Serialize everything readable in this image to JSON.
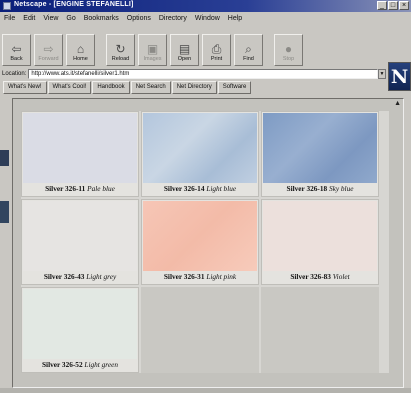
{
  "window": {
    "title": "Netscape - [ENGINE STEFANELLI]"
  },
  "menu": [
    "File",
    "Edit",
    "View",
    "Go",
    "Bookmarks",
    "Options",
    "Directory",
    "Window",
    "Help"
  ],
  "toolbar": [
    {
      "label": "Back",
      "icon": "back-arrow-icon",
      "glyph": "⇦",
      "enabled": true
    },
    {
      "label": "Forward",
      "icon": "forward-arrow-icon",
      "glyph": "⇨",
      "enabled": false
    },
    {
      "label": "Home",
      "icon": "home-icon",
      "glyph": "⌂",
      "enabled": true
    },
    {
      "label": "Reload",
      "icon": "reload-icon",
      "glyph": "↻",
      "enabled": true
    },
    {
      "label": "Images",
      "icon": "images-icon",
      "glyph": "▣",
      "enabled": false
    },
    {
      "label": "Open",
      "icon": "open-icon",
      "glyph": "▤",
      "enabled": true
    },
    {
      "label": "Print",
      "icon": "print-icon",
      "glyph": "⎙",
      "enabled": true
    },
    {
      "label": "Find",
      "icon": "find-icon",
      "glyph": "⌕",
      "enabled": true
    },
    {
      "label": "Stop",
      "icon": "stop-icon",
      "glyph": "●",
      "enabled": false
    }
  ],
  "location": {
    "label": "Location:",
    "url": "http://www.ats.it/stefanelli/silver1.htm"
  },
  "logo": {
    "letter": "N"
  },
  "directory_buttons": [
    "What's New!",
    "What's Cool!",
    "Handbook",
    "Net Search",
    "Net Directory",
    "Software"
  ],
  "swatches": [
    {
      "code": "Silver 326-11",
      "name": "Pale blue",
      "color": "#dadce5"
    },
    {
      "code": "Silver 326-14",
      "name": "Light blue",
      "color": "#b3c6dd"
    },
    {
      "code": "Silver 326-18",
      "name": "Sky blue",
      "color": "#7e9bc4"
    },
    {
      "code": "Silver 326-43",
      "name": "Light grey",
      "color": "#e6e4e2"
    },
    {
      "code": "Silver 326-31",
      "name": "Light pink",
      "color": "#f6c6b6"
    },
    {
      "code": "Silver 326-83",
      "name": "Violet",
      "color": "#ece0dc"
    },
    {
      "code": "Silver 326-52",
      "name": "Light green",
      "color": "#e2e8e3"
    }
  ]
}
